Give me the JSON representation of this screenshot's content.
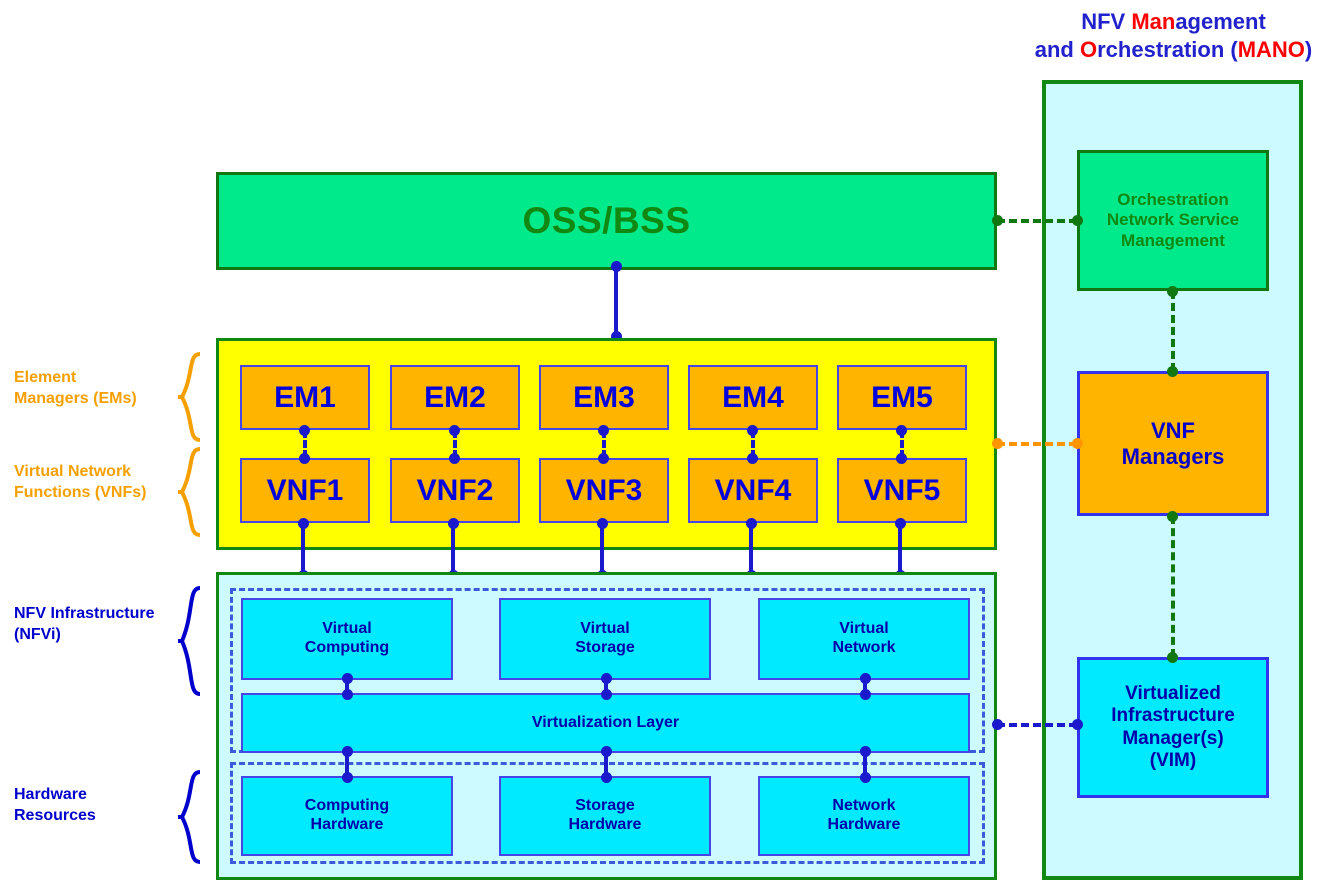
{
  "mano": {
    "title_line1_pre": "NFV ",
    "title_line1_hl": "Man",
    "title_line1_post": "agement",
    "title_line2_pre": "and ",
    "title_line2_hl": "O",
    "title_line2_mid": "rchestration (",
    "title_line2_hl2": "MANO",
    "title_line2_post": ")",
    "boxes": [
      {
        "id": "orchestration",
        "label": "Orchestration\nNetwork Service\nManagement"
      },
      {
        "id": "vnf-managers",
        "label": "VNF\nManagers"
      },
      {
        "id": "vim",
        "label": "Virtualized\nInfrastructure\nManager(s)\n(VIM)"
      }
    ]
  },
  "ossbss": {
    "label": "OSS/BSS"
  },
  "element_managers": [
    {
      "label": "EM1"
    },
    {
      "label": "EM2"
    },
    {
      "label": "EM3"
    },
    {
      "label": "EM4"
    },
    {
      "label": "EM5"
    }
  ],
  "vnfs": [
    {
      "label": "VNF1"
    },
    {
      "label": "VNF2"
    },
    {
      "label": "VNF3"
    },
    {
      "label": "VNF4"
    },
    {
      "label": "VNF5"
    }
  ],
  "virtual_resources": [
    {
      "label": "Virtual\nComputing"
    },
    {
      "label": "Virtual\nStorage"
    },
    {
      "label": "Virtual\nNetwork"
    }
  ],
  "virtualization_layer": {
    "label": "Virtualization Layer"
  },
  "hardware_resources": [
    {
      "label": "Computing\nHardware"
    },
    {
      "label": "Storage\nHardware"
    },
    {
      "label": "Network\nHardware"
    }
  ],
  "side_labels": [
    {
      "id": "element-managers",
      "label": "Element\nManagers (EMs)",
      "color": "#f5a000"
    },
    {
      "id": "vnfs",
      "label": "Virtual Network\nFunctions (VNFs)",
      "color": "#f5a000"
    },
    {
      "id": "nfvi",
      "label": "NFV Infrastructure\n(NFVi)",
      "color": "#0000cc"
    },
    {
      "id": "hardware",
      "label": "Hardware\nResources",
      "color": "#0000cc"
    }
  ],
  "colors": {
    "green_fill": "#00e98a",
    "green_border": "#117711",
    "yellow_panel": "#ffff00",
    "orange_box": "#ffb400",
    "cyan_box": "#00eaff",
    "light_cyan_panel": "#ccfaff",
    "blue_border": "#4646e8",
    "blue_text": "#0000cc",
    "orange_accent": "#ff9500",
    "red_accent": "#ff0000"
  }
}
